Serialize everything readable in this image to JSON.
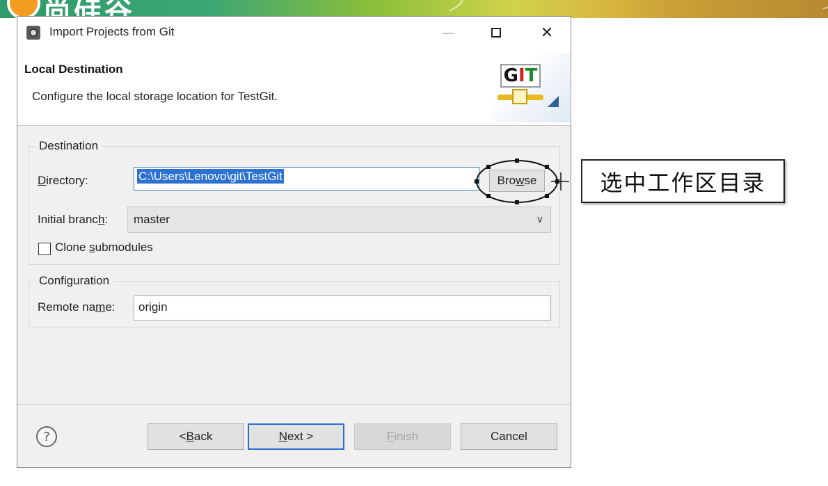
{
  "banner": {
    "logo_text": "尚硅谷"
  },
  "dialog": {
    "title": "Import Projects from Git",
    "header": {
      "title": "Local Destination",
      "description": "Configure the local storage location for TestGit.",
      "logo": {
        "g": "G",
        "i": "I",
        "t": "T"
      }
    },
    "window_controls": {
      "minimize": "—",
      "close": "✕"
    },
    "destination": {
      "group_label": "Destination",
      "directory": {
        "label_pre": "",
        "label_mnemonic": "D",
        "label_post": "irectory:",
        "value": "C:\\Users\\Lenovo\\git\\TestGit"
      },
      "browse": {
        "pre": "Bro",
        "mnemonic": "w",
        "post": "se"
      },
      "initial_branch": {
        "label_pre": "Initial branc",
        "label_mnemonic": "h",
        "label_post": ":",
        "value": "master",
        "chevron": "∨"
      },
      "clone_submodules": {
        "label_pre": "Clone ",
        "label_mnemonic": "s",
        "label_post": "ubmodules",
        "checked": false
      }
    },
    "configuration": {
      "group_label": "Configuration",
      "remote_name": {
        "label_pre": "Remote na",
        "label_mnemonic": "m",
        "label_post": "e:",
        "value": "origin"
      }
    },
    "buttons": {
      "help": "?",
      "back": {
        "pre": "< ",
        "mnemonic": "B",
        "post": "ack"
      },
      "next": {
        "pre": "",
        "mnemonic": "N",
        "post": "ext >"
      },
      "finish": {
        "pre": "",
        "mnemonic": "F",
        "post": "inish"
      },
      "cancel": "Cancel"
    }
  },
  "annotation": {
    "callout_text": "选中工作区目录"
  },
  "colors": {
    "selection": "#2d72d2",
    "next_border": "#2a6fd0",
    "dialog_bg": "#f0f0f0"
  }
}
